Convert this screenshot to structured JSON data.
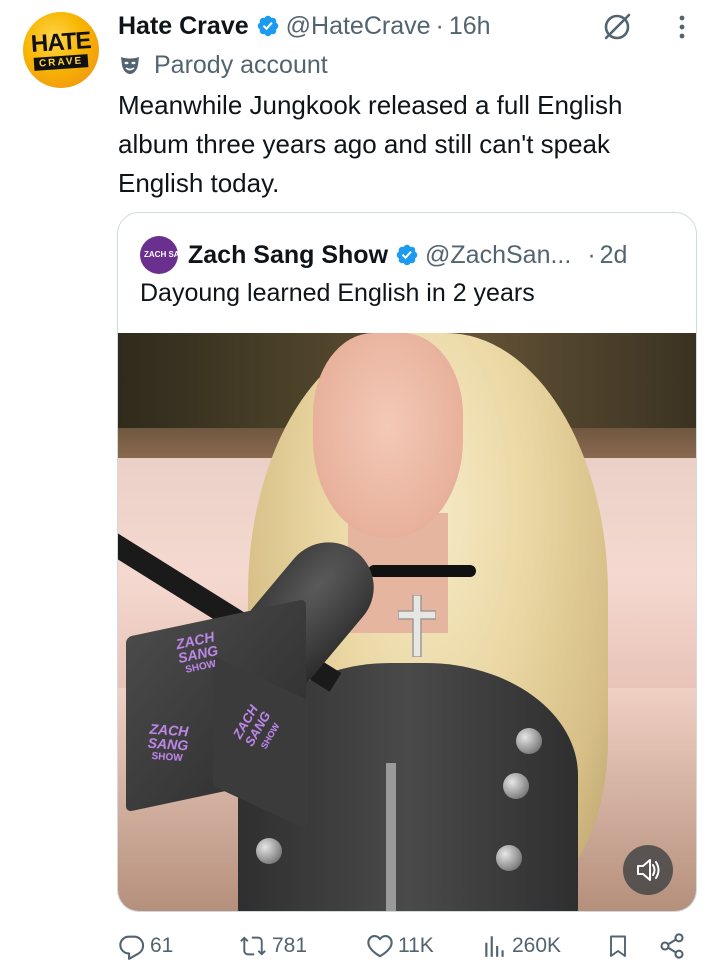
{
  "tweet": {
    "author": {
      "display_name": "Hate Crave",
      "handle": "@HateCrave",
      "separator": "·",
      "time": "16h",
      "parody_label": "Parody account",
      "avatar_text_top": "HATE",
      "avatar_text_bottom": "CRAVE"
    },
    "text": "Meanwhile Jungkook released a full English album three years ago and still can't speak English today.",
    "quoted": {
      "display_name": "Zach Sang Show",
      "handle": "@ZachSan...",
      "separator": "·",
      "time": "2d",
      "text": "Dayoung learned English in 2 years",
      "avatar_text": "ZACH SANG",
      "media": {
        "type": "video",
        "mic_cube_label_line1": "ZACH",
        "mic_cube_label_line2": "SANG",
        "mic_cube_label_line3": "SHOW",
        "volume_icon": "speaker-icon"
      }
    },
    "actions": {
      "replies": "61",
      "reposts": "781",
      "likes": "11K",
      "views": "260K"
    }
  },
  "colors": {
    "verified": "#1d9bf0",
    "secondary_text": "#536471",
    "primary_text": "#0f1419",
    "border": "#cfd9de"
  }
}
